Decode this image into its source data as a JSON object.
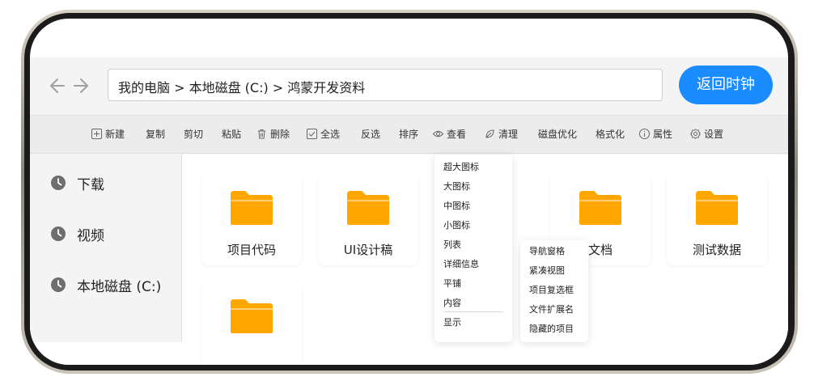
{
  "nav": {
    "back_icon": "arrow-left-icon",
    "forward_icon": "arrow-right-icon"
  },
  "address": {
    "path": "我的电脑 > 本地磁盘 (C:) > 鸿蒙开发资料"
  },
  "back_clock_label": "返回时钟",
  "accent_color": "#1a8cff",
  "folder_color": "#ffa700",
  "toolbar": {
    "new": "新建",
    "copy": "复制",
    "cut": "剪切",
    "paste": "粘贴",
    "delete": "删除",
    "select_all": "全选",
    "invert": "反选",
    "sort": "排序",
    "view": "查看",
    "clean": "清理",
    "optimize": "磁盘优化",
    "format": "格式化",
    "properties": "属性",
    "settings": "设置"
  },
  "sidebar": {
    "items": [
      {
        "label": "下载",
        "icon": "clock-icon"
      },
      {
        "label": "视频",
        "icon": "clock-icon"
      },
      {
        "label": "本地磁盘 (C:)",
        "icon": "clock-icon"
      }
    ]
  },
  "folders": [
    {
      "name": "项目代码"
    },
    {
      "name": "UI设计稿"
    },
    {
      "name": "文档"
    },
    {
      "name": "测试数据"
    },
    {
      "name": ""
    }
  ],
  "view_menu": {
    "items": [
      "超大图标",
      "大图标",
      "中图标",
      "小图标",
      "列表",
      "详细信息",
      "平铺",
      "内容"
    ],
    "show": "显示"
  },
  "show_submenu": {
    "items": [
      "导航窗格",
      "紧凑视图",
      "项目复选框",
      "文件扩展名",
      "隐藏的项目"
    ]
  }
}
